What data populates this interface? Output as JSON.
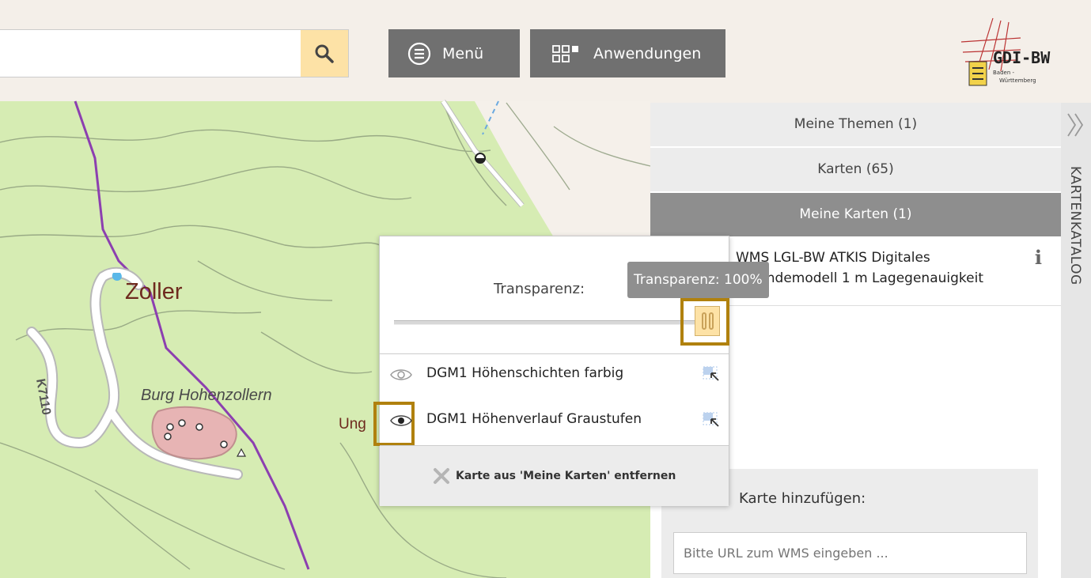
{
  "header": {
    "search_placeholder": "",
    "menu_label": "Menü",
    "apps_label": "Anwendungen",
    "logo_text": "GDI-BW",
    "logo_subtext_1": "Baden -",
    "logo_subtext_2": "Württemberg"
  },
  "map": {
    "labels": {
      "zoller": "Zoller",
      "burg": "Burg Hohenzollern",
      "road": "K7110",
      "partial": "Ung"
    }
  },
  "panel": {
    "tabs": [
      {
        "label": "Meine Themen (1)"
      },
      {
        "label": "Karten (65)"
      },
      {
        "label": "Meine Karten (1)"
      }
    ],
    "layer_title": "WMS LGL-BW ATKIS Digitales Geländemodell 1 m Lagegenauigkeit",
    "add_label": "Karte hinzufügen:",
    "url_placeholder": "Bitte URL zum WMS eingeben ..."
  },
  "side": {
    "label": "KARTENKATALOG"
  },
  "popup": {
    "transparency_label": "Transparenz:",
    "tooltip": "Transparenz: 100%",
    "transparency_value": 100,
    "sublayers": [
      {
        "name": "DGM1 Höhenschichten farbig",
        "visible": false
      },
      {
        "name": "DGM1 Höhenverlauf Graustufen",
        "visible": true
      }
    ],
    "remove_label": "Karte aus 'Meine Karten' entfernen"
  },
  "colors": {
    "accent": "#fde2a6",
    "highlight": "#b0810e",
    "button_gray": "#707070",
    "map_green": "#d4edb0"
  }
}
